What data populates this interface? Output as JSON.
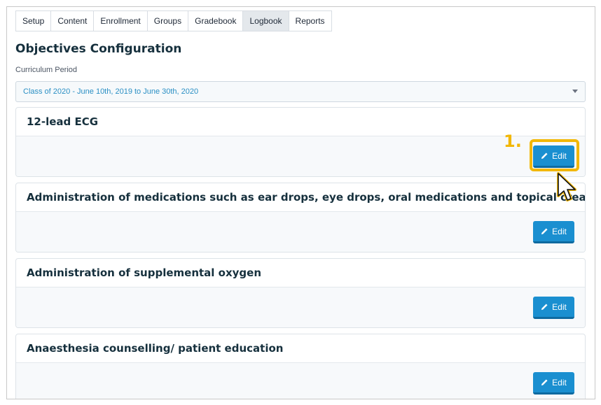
{
  "tabs": [
    {
      "label": "Setup",
      "active": false
    },
    {
      "label": "Content",
      "active": false
    },
    {
      "label": "Enrollment",
      "active": false
    },
    {
      "label": "Groups",
      "active": false
    },
    {
      "label": "Gradebook",
      "active": false
    },
    {
      "label": "Logbook",
      "active": true
    },
    {
      "label": "Reports",
      "active": false
    }
  ],
  "page_title": "Objectives Configuration",
  "curriculum": {
    "label": "Curriculum Period",
    "selected": "Class of 2020 - June 10th, 2019 to June 30th, 2020"
  },
  "objectives": [
    {
      "title": "12-lead ECG",
      "edit_label": "Edit"
    },
    {
      "title": "Administration of medications such as ear drops, eye drops, oral medications and topical creams",
      "edit_label": "Edit"
    },
    {
      "title": "Administration of supplemental oxygen",
      "edit_label": "Edit"
    },
    {
      "title": "Anaesthesia counselling/ patient education",
      "edit_label": "Edit"
    }
  ],
  "annotation": {
    "step": "1.",
    "color": "#f2b705"
  },
  "icons": {
    "edit": "pencil-icon",
    "dropdown": "caret-down-icon",
    "cursor": "mouse-pointer-icon"
  },
  "colors": {
    "accent": "#1a8fd0",
    "select_text": "#2a8fc4",
    "highlight": "#f2b705"
  }
}
